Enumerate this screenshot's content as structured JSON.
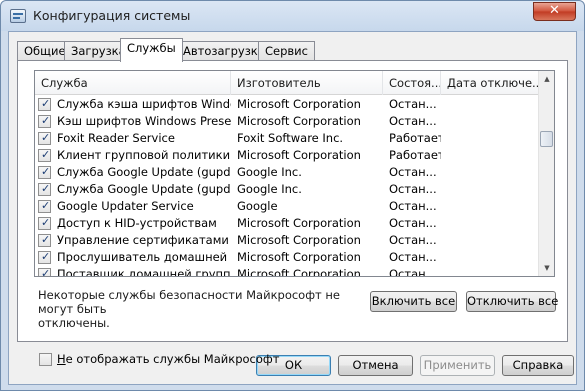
{
  "window": {
    "title": "Конфигурация системы",
    "close_glyph": "✕"
  },
  "tabs": [
    {
      "label": "Общие",
      "active": false
    },
    {
      "label": "Загрузка",
      "active": false
    },
    {
      "label": "Службы",
      "active": true
    },
    {
      "label": "Автозагрузка",
      "active": false
    },
    {
      "label": "Сервис",
      "active": false
    }
  ],
  "services": {
    "columns": [
      "Служба",
      "Изготовитель",
      "Состоя...",
      "Дата отключе..."
    ],
    "rows": [
      {
        "checked": true,
        "name": "Служба кэша шрифтов Windows",
        "vendor": "Microsoft Corporation",
        "status": "Остан...",
        "date": ""
      },
      {
        "checked": true,
        "name": "Кэш шрифтов Windows Present...",
        "vendor": "Microsoft Corporation",
        "status": "Остан...",
        "date": ""
      },
      {
        "checked": true,
        "name": "Foxit Reader Service",
        "vendor": "Foxit Software Inc.",
        "status": "Работает",
        "date": ""
      },
      {
        "checked": true,
        "name": "Клиент групповой политики",
        "vendor": "Microsoft Corporation",
        "status": "Работает",
        "date": ""
      },
      {
        "checked": true,
        "name": "Служба Google Update (gupdate)",
        "vendor": "Google Inc.",
        "status": "Остан...",
        "date": ""
      },
      {
        "checked": true,
        "name": "Служба Google Update (gupdate...",
        "vendor": "Google Inc.",
        "status": "Остан...",
        "date": ""
      },
      {
        "checked": true,
        "name": "Google Updater Service",
        "vendor": "Google",
        "status": "Остан...",
        "date": ""
      },
      {
        "checked": true,
        "name": "Доступ к HID-устройствам",
        "vendor": "Microsoft Corporation",
        "status": "Остан...",
        "date": ""
      },
      {
        "checked": true,
        "name": "Управление сертификатами и ...",
        "vendor": "Microsoft Corporation",
        "status": "Остан...",
        "date": ""
      },
      {
        "checked": true,
        "name": "Прослушиватель домашней гр...",
        "vendor": "Microsoft Corporation",
        "status": "Остан...",
        "date": ""
      },
      {
        "checked": true,
        "name": "Поставщик домашней группы",
        "vendor": "Microsoft Corporation",
        "status": "Остан...",
        "date": ""
      }
    ],
    "check_glyph": "✓"
  },
  "scrollbar": {
    "up_glyph": "▲",
    "down_glyph": "▼"
  },
  "note": {
    "line1": "Некоторые службы безопасности Майкрософт не могут быть",
    "line2": "отключены."
  },
  "buttons": {
    "enable_all": "Включить все",
    "disable_all": "Отключить все",
    "ok": "ОК",
    "cancel": "Отмена",
    "apply": "Применить",
    "help": "Справка"
  },
  "hide_ms": {
    "label_first": "Н",
    "label_rest": "е отображать службы Майкрософт",
    "checked": false
  }
}
